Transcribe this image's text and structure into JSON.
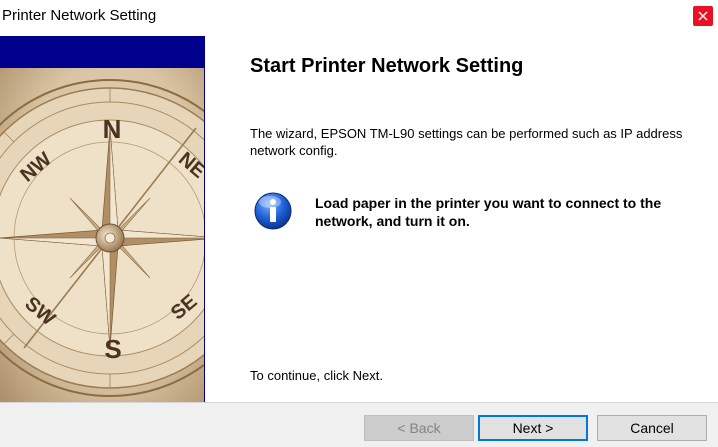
{
  "window": {
    "title": "Printer Network Setting",
    "close_icon": "close-icon"
  },
  "main": {
    "heading": "Start Printer Network Setting",
    "description": "The wizard, EPSON TM-L90 settings can be performed such as IP address network config.",
    "notice_icon": "info-icon",
    "notice": "Load paper in the printer you want to connect to the network, and turn it on.",
    "continue_text": "To continue, click Next."
  },
  "side_image": {
    "compass_letters": [
      "N",
      "NE",
      "NW",
      "S",
      "SW",
      "SE"
    ]
  },
  "buttons": {
    "back": "< Back",
    "next": "Next >",
    "cancel": "Cancel"
  },
  "colors": {
    "side_band": "#00008c",
    "close_button": "#e81123",
    "default_button_border": "#0078d7"
  }
}
